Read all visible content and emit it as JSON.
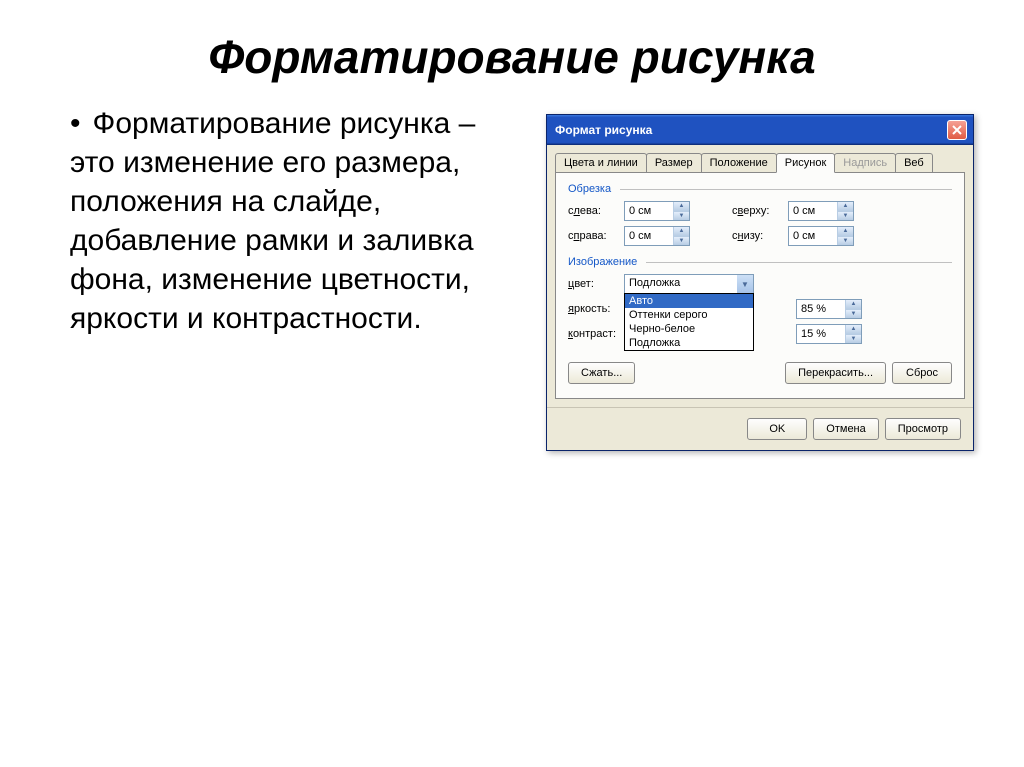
{
  "slide": {
    "title": "Форматирование рисунка",
    "bullet": "Форматирование рисунка – это изменение его размера, положения на слайде, добавление рамки и заливка фона, изменение цветности, яркости и контрастности."
  },
  "dialog": {
    "title": "Формат рисунка",
    "tabs": {
      "colors": "Цвета и линии",
      "size": "Размер",
      "position": "Положение",
      "picture": "Рисунок",
      "textbox": "Надпись",
      "web": "Веб"
    },
    "crop": {
      "group": "Обрезка",
      "left_label": "слева:",
      "right_label": "справа:",
      "top_label": "сверху:",
      "bottom_label": "снизу:",
      "left": "0 см",
      "right": "0 см",
      "top": "0 см",
      "bottom": "0 см"
    },
    "image": {
      "group": "Изображение",
      "color_label": "цвет:",
      "brightness_label": "яркость:",
      "contrast_label": "контраст:",
      "color_value": "Подложка",
      "options": [
        "Авто",
        "Оттенки серого",
        "Черно-белое",
        "Подложка"
      ],
      "brightness": "85 %",
      "contrast": "15 %"
    },
    "buttons": {
      "compress": "Сжать...",
      "recolor": "Перекрасить...",
      "reset": "Сброс",
      "ok": "OK",
      "cancel": "Отмена",
      "preview": "Просмотр"
    }
  }
}
